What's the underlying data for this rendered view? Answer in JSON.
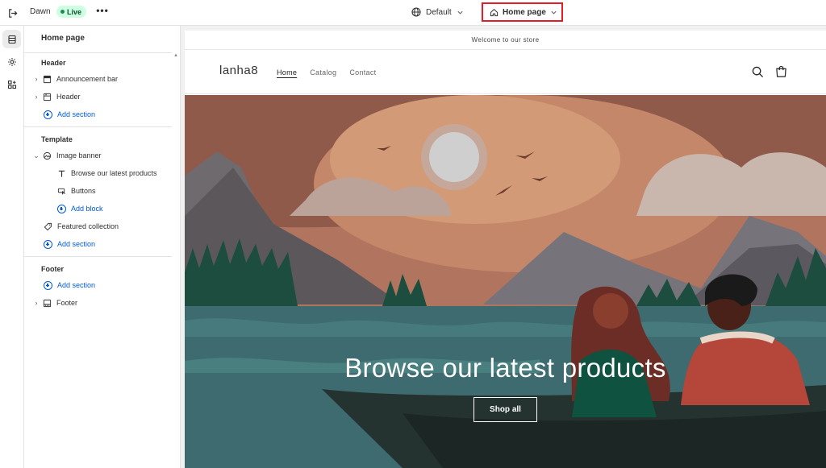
{
  "topbar": {
    "theme_name": "Dawn",
    "status_badge": "Live",
    "more_label": "•••",
    "template_selector": "Default",
    "page_selector": "Home page"
  },
  "sidebar": {
    "title": "Home page",
    "header_group": {
      "label": "Header",
      "items": [
        {
          "label": "Announcement bar",
          "icon": "announcement-icon"
        },
        {
          "label": "Header",
          "icon": "header-icon"
        }
      ],
      "add_section": "Add section"
    },
    "template_group": {
      "label": "Template",
      "image_banner": "Image banner",
      "blocks": [
        {
          "label": "Browse our latest products",
          "icon": "text-icon"
        },
        {
          "label": "Buttons",
          "icon": "button-icon"
        }
      ],
      "add_block": "Add block",
      "featured_collection": "Featured collection",
      "add_section": "Add section"
    },
    "footer_group": {
      "label": "Footer",
      "add_section": "Add section",
      "footer_item": "Footer"
    }
  },
  "preview": {
    "announcement": "Welcome to our store",
    "store_name": "lanha8",
    "nav": [
      "Home",
      "Catalog",
      "Contact"
    ],
    "banner_heading": "Browse our latest products",
    "banner_button": "Shop all"
  },
  "colors": {
    "accent": "#005bd3",
    "live_bg": "#cdfee1",
    "highlight_border": "#e51c23"
  }
}
